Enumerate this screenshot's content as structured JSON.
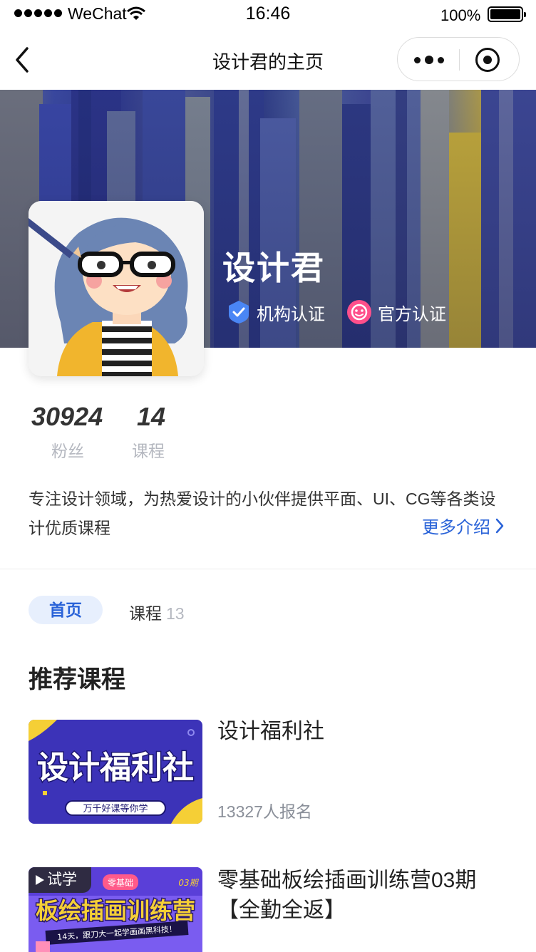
{
  "status_bar": {
    "carrier": "WeChat",
    "time": "16:46",
    "battery": "100%"
  },
  "nav": {
    "title": "设计君的主页"
  },
  "profile": {
    "name": "设计君",
    "badges": [
      {
        "label": "机构认证",
        "icon": "verified-shield-icon",
        "color": "#4a86f5"
      },
      {
        "label": "官方认证",
        "icon": "official-smile-icon",
        "color": "#ff4f8b"
      }
    ],
    "stats": [
      {
        "value": "30924",
        "label": "粉丝"
      },
      {
        "value": "14",
        "label": "课程"
      }
    ],
    "intro": "专注设计领域，为热爱设计的小伙伴提供平面、UI、CG等各类设计优质课程",
    "more_intro": "更多介绍"
  },
  "tabs": {
    "home": "首页",
    "courses": "课程",
    "courses_count": "13"
  },
  "section": {
    "title": "推荐课程"
  },
  "courses": [
    {
      "title": "设计福利社",
      "enroll": "13327人报名",
      "thumb_title": "设计福利社",
      "thumb_subtitle": "万千好课等你学"
    },
    {
      "title": "零基础板绘插画训练营03期【全勤全返】",
      "trial": "试学",
      "thumb_badge": "零基础",
      "thumb_period": "03期",
      "thumb_title": "板绘插画训练营",
      "thumb_subtitle": "14天，跟刀大一起学画画黑科技！"
    }
  ],
  "colors": {
    "accent": "#2a63d8",
    "tab_bg": "#e7effd",
    "muted": "#b5b8c0"
  }
}
